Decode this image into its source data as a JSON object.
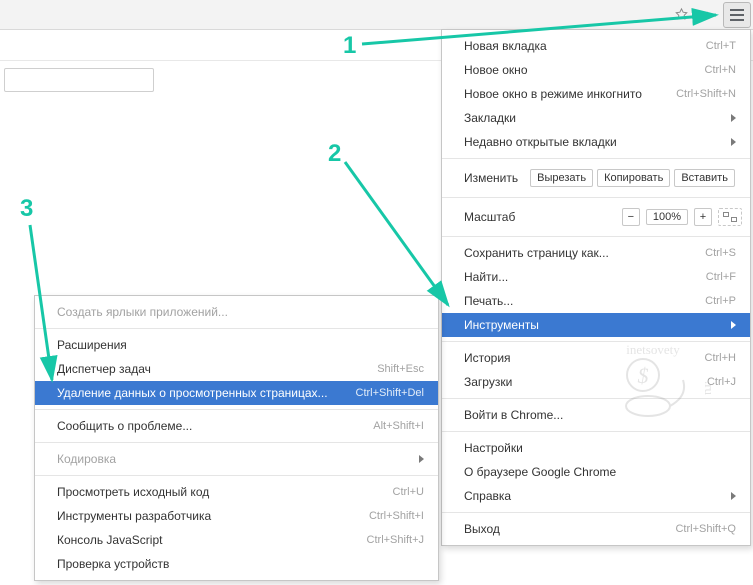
{
  "toolbar": {
    "star_title": "Добавить в закладки",
    "menu_title": "Настройка и управление Google Chrome"
  },
  "callouts": {
    "c1": "1",
    "c2": "2",
    "c3": "3"
  },
  "main_menu": {
    "new_tab": {
      "label": "Новая вкладка",
      "shortcut": "Ctrl+T"
    },
    "new_window": {
      "label": "Новое окно",
      "shortcut": "Ctrl+N"
    },
    "incognito": {
      "label": "Новое окно в режиме инкогнито",
      "shortcut": "Ctrl+Shift+N"
    },
    "bookmarks": {
      "label": "Закладки"
    },
    "recent_tabs": {
      "label": "Недавно открытые вкладки"
    },
    "edit_label": "Изменить",
    "cut": "Вырезать",
    "copy": "Копировать",
    "paste": "Вставить",
    "zoom_label": "Масштаб",
    "zoom_value": "100%",
    "save_page": {
      "label": "Сохранить страницу как...",
      "shortcut": "Ctrl+S"
    },
    "find": {
      "label": "Найти...",
      "shortcut": "Ctrl+F"
    },
    "print": {
      "label": "Печать...",
      "shortcut": "Ctrl+P"
    },
    "tools": {
      "label": "Инструменты"
    },
    "history": {
      "label": "История",
      "shortcut": "Ctrl+H"
    },
    "downloads": {
      "label": "Загрузки",
      "shortcut": "Ctrl+J"
    },
    "signin": {
      "label": "Войти в Chrome..."
    },
    "settings": {
      "label": "Настройки"
    },
    "about": {
      "label": "О браузере Google Chrome"
    },
    "help": {
      "label": "Справка"
    },
    "exit": {
      "label": "Выход",
      "shortcut": "Ctrl+Shift+Q"
    }
  },
  "sub_menu": {
    "create_shortcuts": {
      "label": "Создать ярлыки приложений..."
    },
    "extensions": {
      "label": "Расширения"
    },
    "task_manager": {
      "label": "Диспетчер задач",
      "shortcut": "Shift+Esc"
    },
    "clear_data": {
      "label": "Удаление данных о просмотренных страницах...",
      "shortcut": "Ctrl+Shift+Del"
    },
    "report_issue": {
      "label": "Сообщить о проблеме...",
      "shortcut": "Alt+Shift+I"
    },
    "encoding": {
      "label": "Кодировка"
    },
    "view_source": {
      "label": "Просмотреть исходный код",
      "shortcut": "Ctrl+U"
    },
    "dev_tools": {
      "label": "Инструменты разработчика",
      "shortcut": "Ctrl+Shift+I"
    },
    "js_console": {
      "label": "Консоль JavaScript",
      "shortcut": "Ctrl+Shift+J"
    },
    "device_inspect": {
      "label": "Проверка устройств"
    }
  },
  "watermark": {
    "text_top": "inetsovety",
    "text_side": ".ru"
  }
}
